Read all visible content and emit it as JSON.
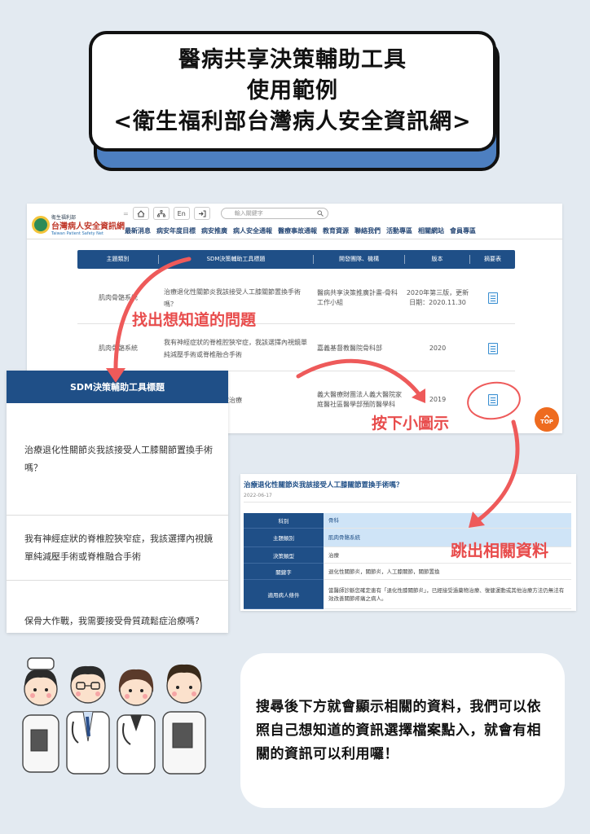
{
  "title": {
    "line1": "醫病共享決策輔助工具",
    "line2": "使用範例",
    "line3": "<衛生福利部台灣病人安全資訊網>"
  },
  "site": {
    "logo_small": "衛生福利部",
    "logo_main": "台灣病人安全資訊網",
    "logo_en": "Taiwan Patient Safety Net",
    "toolbar": {
      "home_icon": "home-icon",
      "sitemap_icon": "sitemap-icon",
      "lang_label": "En",
      "login_icon": "login-icon"
    },
    "search_placeholder": "輸入關鍵字",
    "nav": [
      "最新消息",
      "病安年度目標",
      "病安推廣",
      "病人安全通報",
      "醫療事故通報",
      "教育資源",
      "聯絡我們",
      "活動專區",
      "相關網站",
      "會員專區"
    ],
    "table_headers": [
      "主題類別",
      "SDM決策輔助工具標題",
      "開發團隊、機構",
      "版本",
      "摘要表"
    ],
    "rows": [
      {
        "category": "肌肉骨骼系統",
        "title": "治療退化性關節炎我該接受人工膝關節置換手術嗎？",
        "org": "醫病共享決策推廣計畫-骨科工作小組",
        "version": "2020年第三版，更新日期：2020.11.30"
      },
      {
        "category": "肌肉骨骼系統",
        "title": "我有神經症狀的脊椎腔狹窄症，我該選擇內視鏡單純減壓手術或脊椎融合手術",
        "org": "嘉義基督教醫院骨科部",
        "version": "2020"
      },
      {
        "category": "",
        "title": "我需要接受骨質疏鬆症治療",
        "org": "義大醫療財團法人義大醫院家庭醫社區醫學部預防醫學科",
        "version": "2019"
      }
    ],
    "top_label": "TOP"
  },
  "callouts": {
    "find": "找出想知道的問題",
    "click": "按下小圖示",
    "popup": "跳出相關資料"
  },
  "sdm_list": {
    "header": "SDM決策輔助工具標題",
    "items": [
      "治療退化性關節炎我該接受人工膝關節置換手術嗎？",
      "我有神經症狀的脊椎腔狹窄症，我該選擇內視鏡單純減壓手術或脊椎融合手術",
      "保骨大作戰，我需要接受骨質疏鬆症治療嗎?"
    ]
  },
  "detail": {
    "title": "治療退化性關節炎我該接受人工膝關節置換手術嗎？",
    "date": "2022-06-17",
    "rows": [
      {
        "key": "科別",
        "value": "骨科"
      },
      {
        "key": "主題類別",
        "value": "肌肉骨骼系統"
      },
      {
        "key": "決策類型",
        "value": "治療"
      },
      {
        "key": "關鍵字",
        "value": "退化性關節炎，關節炎，人工膝關節，關節置換"
      },
      {
        "key": "適用病人條件",
        "value": "當醫師診斷您確定患有「退化性膝關節炎」，已經接受過藥物治療、復健運動或其他治療方法仍無法有效改善關節疼痛之病人。"
      }
    ]
  },
  "bubble_text": "搜尋後下方就會顯示相關的資料，我們可以依照自己想知道的資訊選擇檔案點入，就會有相關的資訊可以利用囉！",
  "colors": {
    "navy": "#1f4f87",
    "accent_red": "#e84c4c",
    "title_shadow": "#4d7fc0",
    "top_orange": "#ee6b1f"
  }
}
